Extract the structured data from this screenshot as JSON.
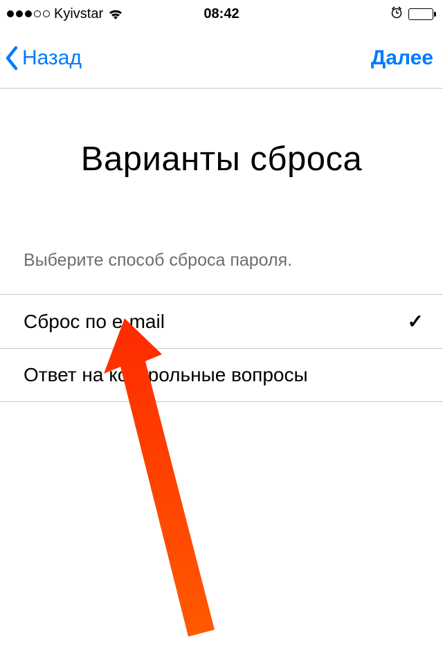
{
  "status_bar": {
    "carrier": "Kyivstar",
    "time": "08:42"
  },
  "nav": {
    "back_label": "Назад",
    "next_label": "Далее"
  },
  "page": {
    "title": "Варианты сброса",
    "subtitle": "Выберите способ сброса пароля."
  },
  "options": [
    {
      "label": "Сброс по e-mail",
      "selected": true
    },
    {
      "label": "Ответ на контрольные вопросы",
      "selected": false
    }
  ]
}
